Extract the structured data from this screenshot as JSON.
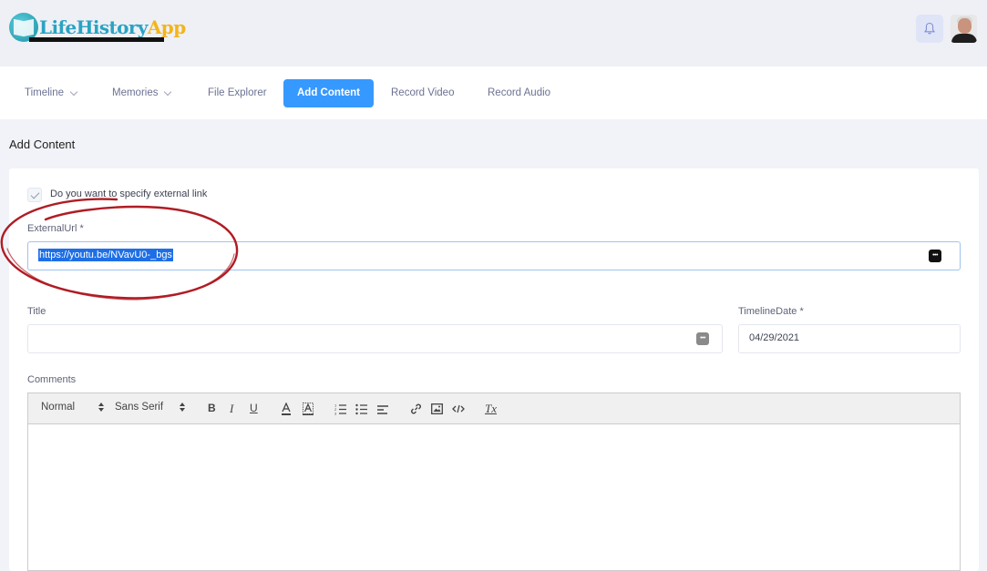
{
  "header": {
    "logo_part1": "LifeHistory",
    "logo_part2": "App",
    "notification_icon": "bell-icon",
    "avatar_icon": "user-avatar"
  },
  "nav": {
    "items": [
      {
        "label": "Timeline",
        "has_dropdown": true
      },
      {
        "label": "Memories",
        "has_dropdown": true
      },
      {
        "label": "File Explorer",
        "has_dropdown": false
      },
      {
        "label": "Add Content",
        "active": true
      },
      {
        "label": "Record Video",
        "has_dropdown": false
      },
      {
        "label": "Record Audio",
        "has_dropdown": false
      }
    ],
    "accent_color": "#3699ff"
  },
  "page": {
    "title": "Add Content"
  },
  "form": {
    "external_link_checkbox": {
      "label": "Do you want to specify external link",
      "checked": true
    },
    "external_url": {
      "label": "ExternalUrl *",
      "value": "https://youtu.be/NVavU0-_bgs",
      "selected": true
    },
    "title": {
      "label": "Title",
      "value": ""
    },
    "timeline_date": {
      "label": "TimelineDate *",
      "value": "04/29/2021"
    },
    "comments": {
      "label": "Comments"
    }
  },
  "editor_toolbar": {
    "format_select": "Normal",
    "font_select": "Sans Serif",
    "bold": "B",
    "italic": "I",
    "underline": "U",
    "clean": "Tx"
  },
  "colors": {
    "annotation_circle": "#b01c24",
    "selection": "#1e6fe6"
  }
}
